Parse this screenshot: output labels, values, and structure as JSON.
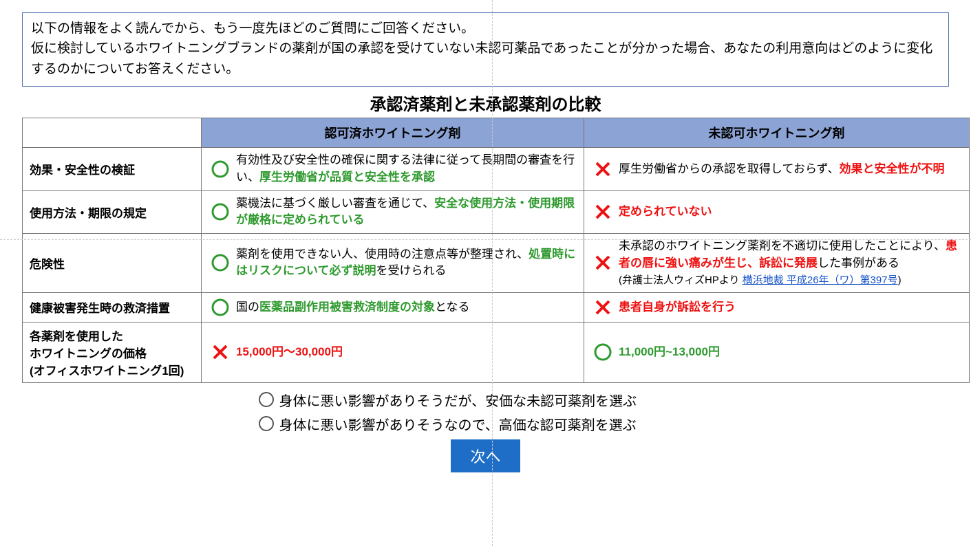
{
  "intro": {
    "line1": "以下の情報をよく読んでから、もう一度先ほどのご質問にご回答ください。",
    "line2": "仮に検討しているホワイトニングブランドの薬剤が国の承認を受けていない未認可薬品であったことが分かった場合、あなたの利用意向はどのように変化するのかについてお答えください。"
  },
  "table": {
    "title": "承認済薬剤と未承認薬剤の比較",
    "headers": {
      "approved": "認可済ホワイトニング剤",
      "unapproved": "未認可ホワイトニング剤"
    },
    "rows": [
      {
        "label": "効果・安全性の検証",
        "approved": {
          "pre": "有効性及び安全性の確保に関する法律に従って長期間の審査を行い、",
          "em": "厚生労働省が品質と安全性を承認"
        },
        "unapproved": {
          "pre": "厚生労働省からの承認を取得しておらず、",
          "em": "効果と安全性が不明"
        }
      },
      {
        "label": "使用方法・期限の規定",
        "approved": {
          "pre": "薬機法に基づく厳しい審査を通じて、",
          "em": "安全な使用方法・使用期限が厳格に定められている"
        },
        "unapproved": {
          "em": "定められていない"
        }
      },
      {
        "label": "危険性",
        "approved": {
          "pre": "薬剤を使用できない人、使用時の注意点等が整理され、",
          "em": "処置時にはリスクについて必ず説明",
          "post": "を受けられる"
        },
        "unapproved": {
          "pre": "未承認のホワイトニング薬剤を不適切に使用したことにより、",
          "em": "患者の唇に強い痛みが生じ、訴訟に発展",
          "post": "した事例がある",
          "src_prefix": "(弁護士法人ウィズHPより ",
          "src_link": "横浜地裁 平成26年（ワ）第397号",
          "src_suffix": ")"
        }
      },
      {
        "label": "健康被害発生時の救済措置",
        "approved": {
          "pre": "国の",
          "em": "医薬品副作用被害救済制度の対象",
          "post": "となる"
        },
        "unapproved": {
          "em": "患者自身が訴訟を行う"
        }
      },
      {
        "label_l1": "各薬剤を使用した",
        "label_l2": "ホワイトニングの価格",
        "label_l3": "(オフィスホワイトニング1回)",
        "approved": {
          "em": "15,000円～30,000円"
        },
        "unapproved": {
          "em": "11,000円~13,000円"
        }
      }
    ]
  },
  "options": [
    "身体に悪い影響がありそうだが、安価な未認可薬剤を選ぶ",
    "身体に悪い影響がありそうなので、高価な認可薬剤を選ぶ"
  ],
  "next_label": "次へ"
}
